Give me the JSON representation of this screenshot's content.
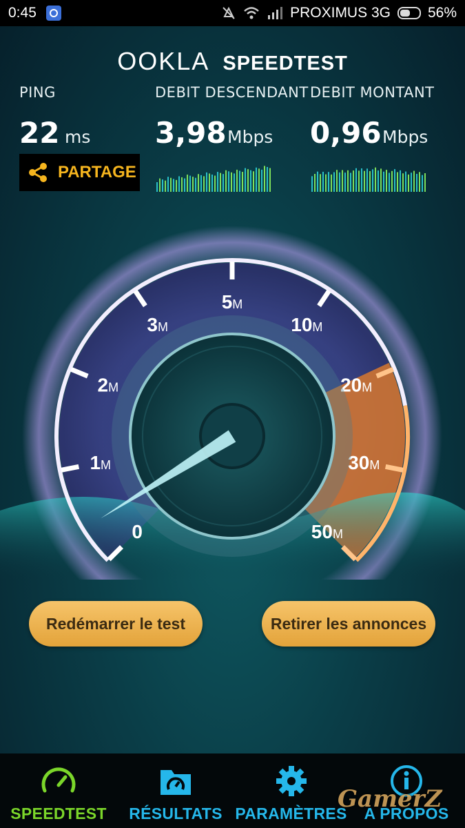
{
  "status_bar": {
    "time": "0:45",
    "carrier": "PROXIMUS 3G",
    "battery": "56%"
  },
  "header": {
    "logo_ookla": "OOKLA",
    "logo_speedtest": "SPEEDTEST"
  },
  "metrics": {
    "ping": {
      "label": "PING",
      "value": "22",
      "unit": "ms"
    },
    "download": {
      "label": "DEBIT DESCENDANT",
      "value": "3,98",
      "unit": "Mbps"
    },
    "upload": {
      "label": "DEBIT MONTANT",
      "value": "0,96",
      "unit": "Mbps"
    }
  },
  "share_label": "PARTAGE",
  "gauge": {
    "ticks": [
      {
        "num": "0",
        "unit": ""
      },
      {
        "num": "1",
        "unit": "M"
      },
      {
        "num": "2",
        "unit": "M"
      },
      {
        "num": "3",
        "unit": "M"
      },
      {
        "num": "5",
        "unit": "M"
      },
      {
        "num": "10",
        "unit": "M"
      },
      {
        "num": "20",
        "unit": "M"
      },
      {
        "num": "30",
        "unit": "M"
      },
      {
        "num": "50",
        "unit": "M"
      }
    ]
  },
  "buttons": {
    "restart": "Redémarrer le test",
    "remove_ads": "Retirer les annonces"
  },
  "nav": [
    {
      "label": "SPEEDTEST",
      "icon": "speedometer-icon",
      "color": "#7bd62a"
    },
    {
      "label": "RÉSULTATS",
      "icon": "results-folder-icon",
      "color": "#25b7ea"
    },
    {
      "label": "PARAMÈTRES",
      "icon": "gear-icon",
      "color": "#25b7ea"
    },
    {
      "label": "A PROPOS",
      "icon": "info-icon",
      "color": "#25b7ea"
    }
  ],
  "watermark": "GamerZ",
  "colors": {
    "accent_orange": "#f6b51e",
    "nav_active": "#7bd62a",
    "nav_inactive": "#25b7ea"
  }
}
